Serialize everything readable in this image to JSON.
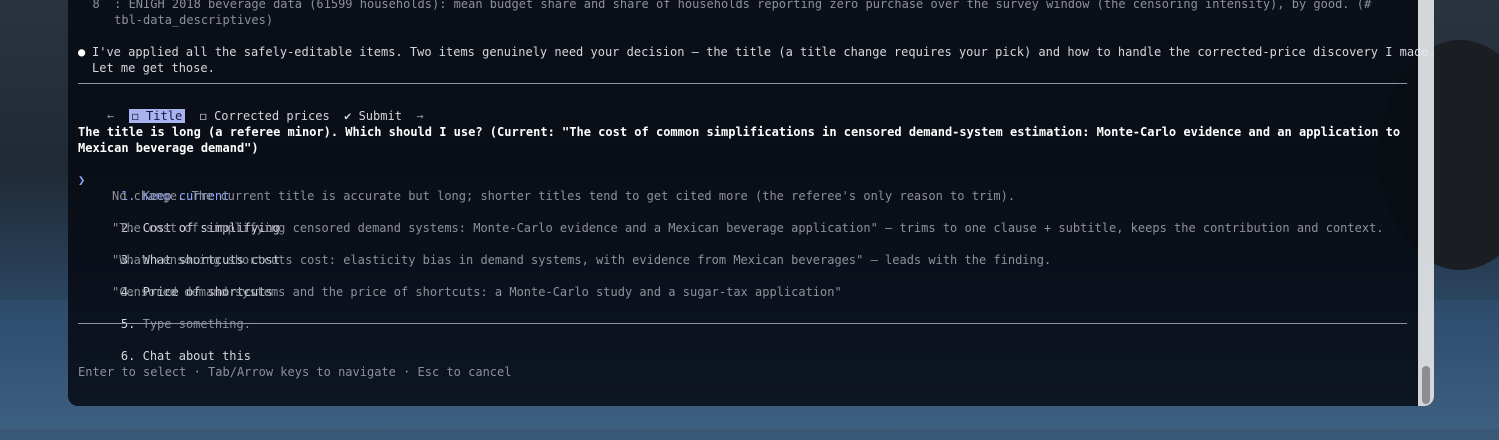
{
  "colors": {
    "terminal_bg": "#060912",
    "selected_tab_bg": "#a9b3f0",
    "selected_option": "#8fa8ff",
    "separator": "#8e94a6"
  },
  "transcript": {
    "list_item_line1": "  8  : ENIGH 2018 beverage data (61599 households): mean budget share and share of households reporting zero purchase over the survey window (the censoring intensity), by good. (#",
    "list_item_line2": "     tbl-data_descriptives)",
    "bullet": "●",
    "message_line1": "I've applied all the safely-editable items. Two items genuinely need your decision — the title (a title change requires your pick) and how to handle the corrected-price discovery I made.",
    "message_line2": "Let me get those."
  },
  "tabs": {
    "left_arrow": "←",
    "right_arrow": "→",
    "items": [
      {
        "label": "◻ Title",
        "selected": true
      },
      {
        "label": "◻ Corrected prices",
        "selected": false
      },
      {
        "label": "✔ Submit",
        "selected": false
      }
    ]
  },
  "question": {
    "line1": "The title is long (a referee minor). Which should I use? (Current: \"The cost of common simplifications in censored demand-system estimation: Monte-Carlo evidence and an application to",
    "line2": "Mexican beverage demand\")"
  },
  "options": {
    "cursor": "❯",
    "items": [
      {
        "number": "1.",
        "title": "Keep current",
        "description": "No change. The current title is accurate but long; shorter titles tend to get cited more (the referee's only reason to trim)."
      },
      {
        "number": "2.",
        "title": "Cost of simplifying",
        "description": "\"The cost of simplifying censored demand systems: Monte-Carlo evidence and a Mexican beverage application\" — trims to one clause + subtitle, keeps the contribution and context."
      },
      {
        "number": "3.",
        "title": "What shortcuts cost",
        "description": "\"What censoring shortcuts cost: elasticity bias in demand systems, with evidence from Mexican beverages\" — leads with the finding."
      },
      {
        "number": "4.",
        "title": "Price of shortcuts",
        "description": "\"Censored demand systems and the price of shortcuts: a Monte-Carlo study and a sugar-tax application\""
      },
      {
        "number": "5.",
        "title": "Type something.",
        "description": ""
      }
    ],
    "chat": {
      "number": "6.",
      "title": "Chat about this"
    }
  },
  "footer": {
    "hint": "Enter to select · Tab/Arrow keys to navigate · Esc to cancel"
  }
}
